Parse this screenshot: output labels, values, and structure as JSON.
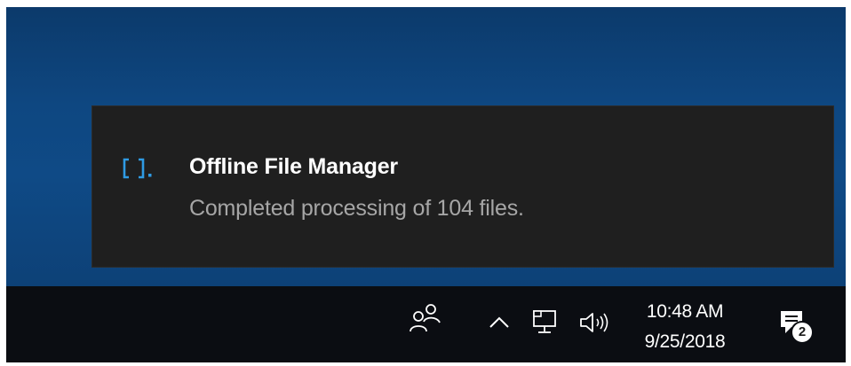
{
  "toast": {
    "app_name": "Offline File Manager",
    "message": "Completed processing of 104 files.",
    "icon": "brackets-app-icon",
    "accent_color": "#2f9be4"
  },
  "taskbar": {
    "people_icon": "people-icon",
    "show_hidden_icon": "chevron-up-icon",
    "network_icon": "network-icon",
    "volume_icon": "volume-icon",
    "time": "10:48 AM",
    "date": "9/25/2018",
    "action_center": {
      "icon": "notifications-icon",
      "badge_count": "2"
    }
  }
}
